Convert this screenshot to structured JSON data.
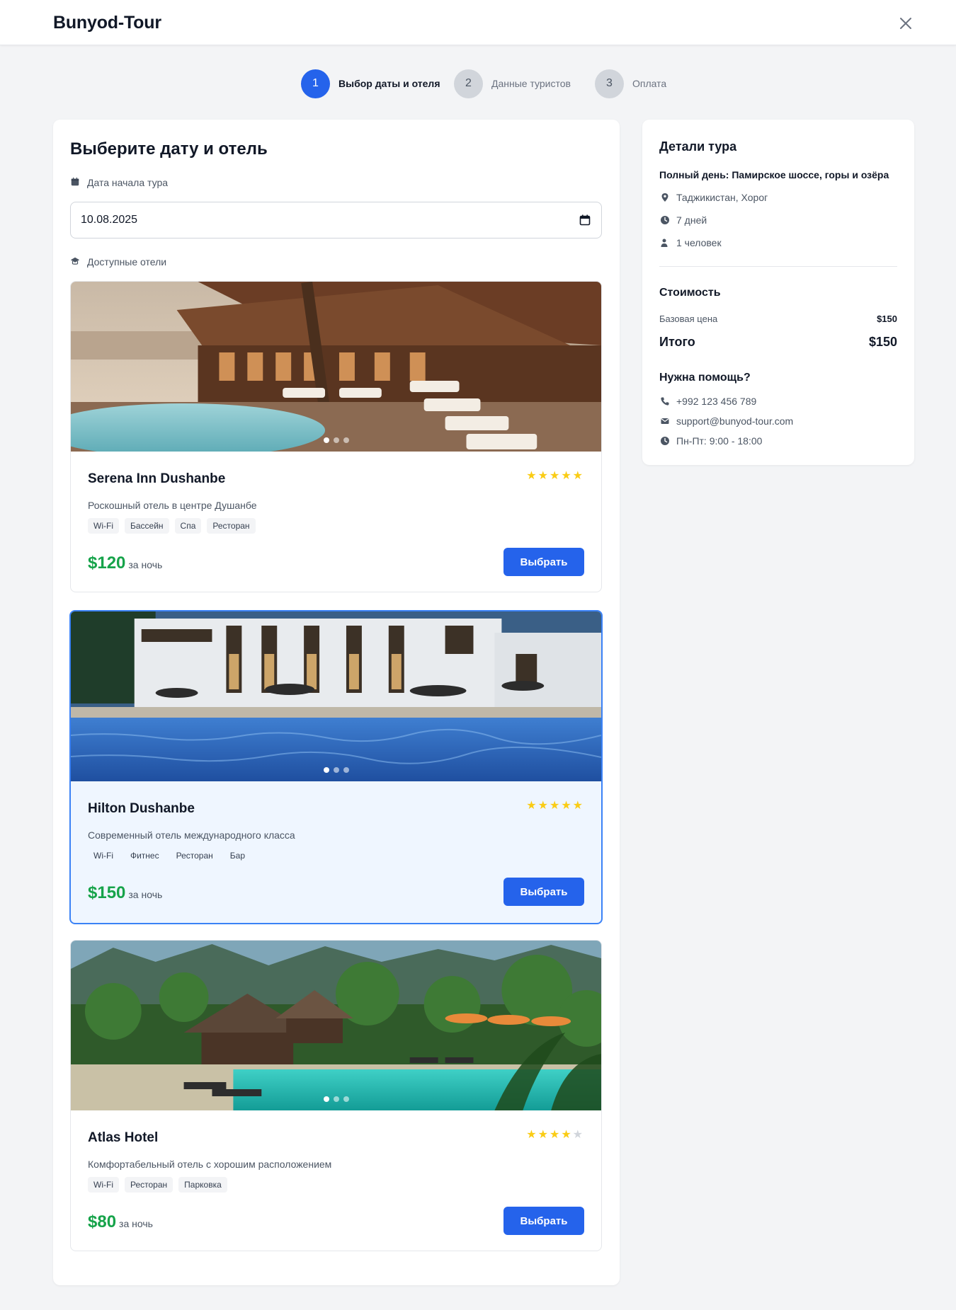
{
  "header": {
    "brand": "Bunyod-Tour"
  },
  "stepper": [
    {
      "number": "1",
      "label": "Выбор даты и отеля"
    },
    {
      "number": "2",
      "label": "Данные туристов"
    },
    {
      "number": "3",
      "label": "Оплата"
    }
  ],
  "main": {
    "title": "Выберите дату и отель",
    "date_label": "Дата начала тура",
    "date_value": "10.08.2025",
    "hotels_label": "Доступные отели",
    "per_night": "за ночь",
    "select_label": "Выбрать"
  },
  "hotels": [
    {
      "name": "Serena Inn Dushanbe",
      "description": "Роскошный отель в центре Душанбе",
      "amenities": [
        "Wi-Fi",
        "Бассейн",
        "Спа",
        "Ресторан"
      ],
      "price": "$120",
      "stars": 5,
      "selected": false
    },
    {
      "name": "Hilton Dushanbe",
      "description": "Современный отель международного класса",
      "amenities": [
        "Wi-Fi",
        "Фитнес",
        "Ресторан",
        "Бар"
      ],
      "price": "$150",
      "stars": 5,
      "selected": true
    },
    {
      "name": "Atlas Hotel",
      "description": "Комфортабельный отель с хорошим расположением",
      "amenities": [
        "Wi-Fi",
        "Ресторан",
        "Парковка"
      ],
      "price": "$80",
      "stars": 4,
      "selected": false
    }
  ],
  "sidebar": {
    "title": "Детали тура",
    "tour_name": "Полный день: Памирское шоссе, горы и озёра",
    "location": "Таджикистан, Хорог",
    "duration": "7 дней",
    "people": "1 человек",
    "cost_title": "Стоимость",
    "base_label": "Базовая цена",
    "base_value": "$150",
    "total_label": "Итого",
    "total_value": "$150",
    "help_title": "Нужна помощь?",
    "phone": "+992 123 456 789",
    "email": "support@bunyod-tour.com",
    "hours": "Пн-Пт: 9:00 - 18:00"
  },
  "colors": {
    "accent": "#2563eb",
    "price": "#16a34a",
    "star": "#facc15",
    "selected_border": "#3b82f6",
    "selected_bg": "#eff6ff"
  }
}
